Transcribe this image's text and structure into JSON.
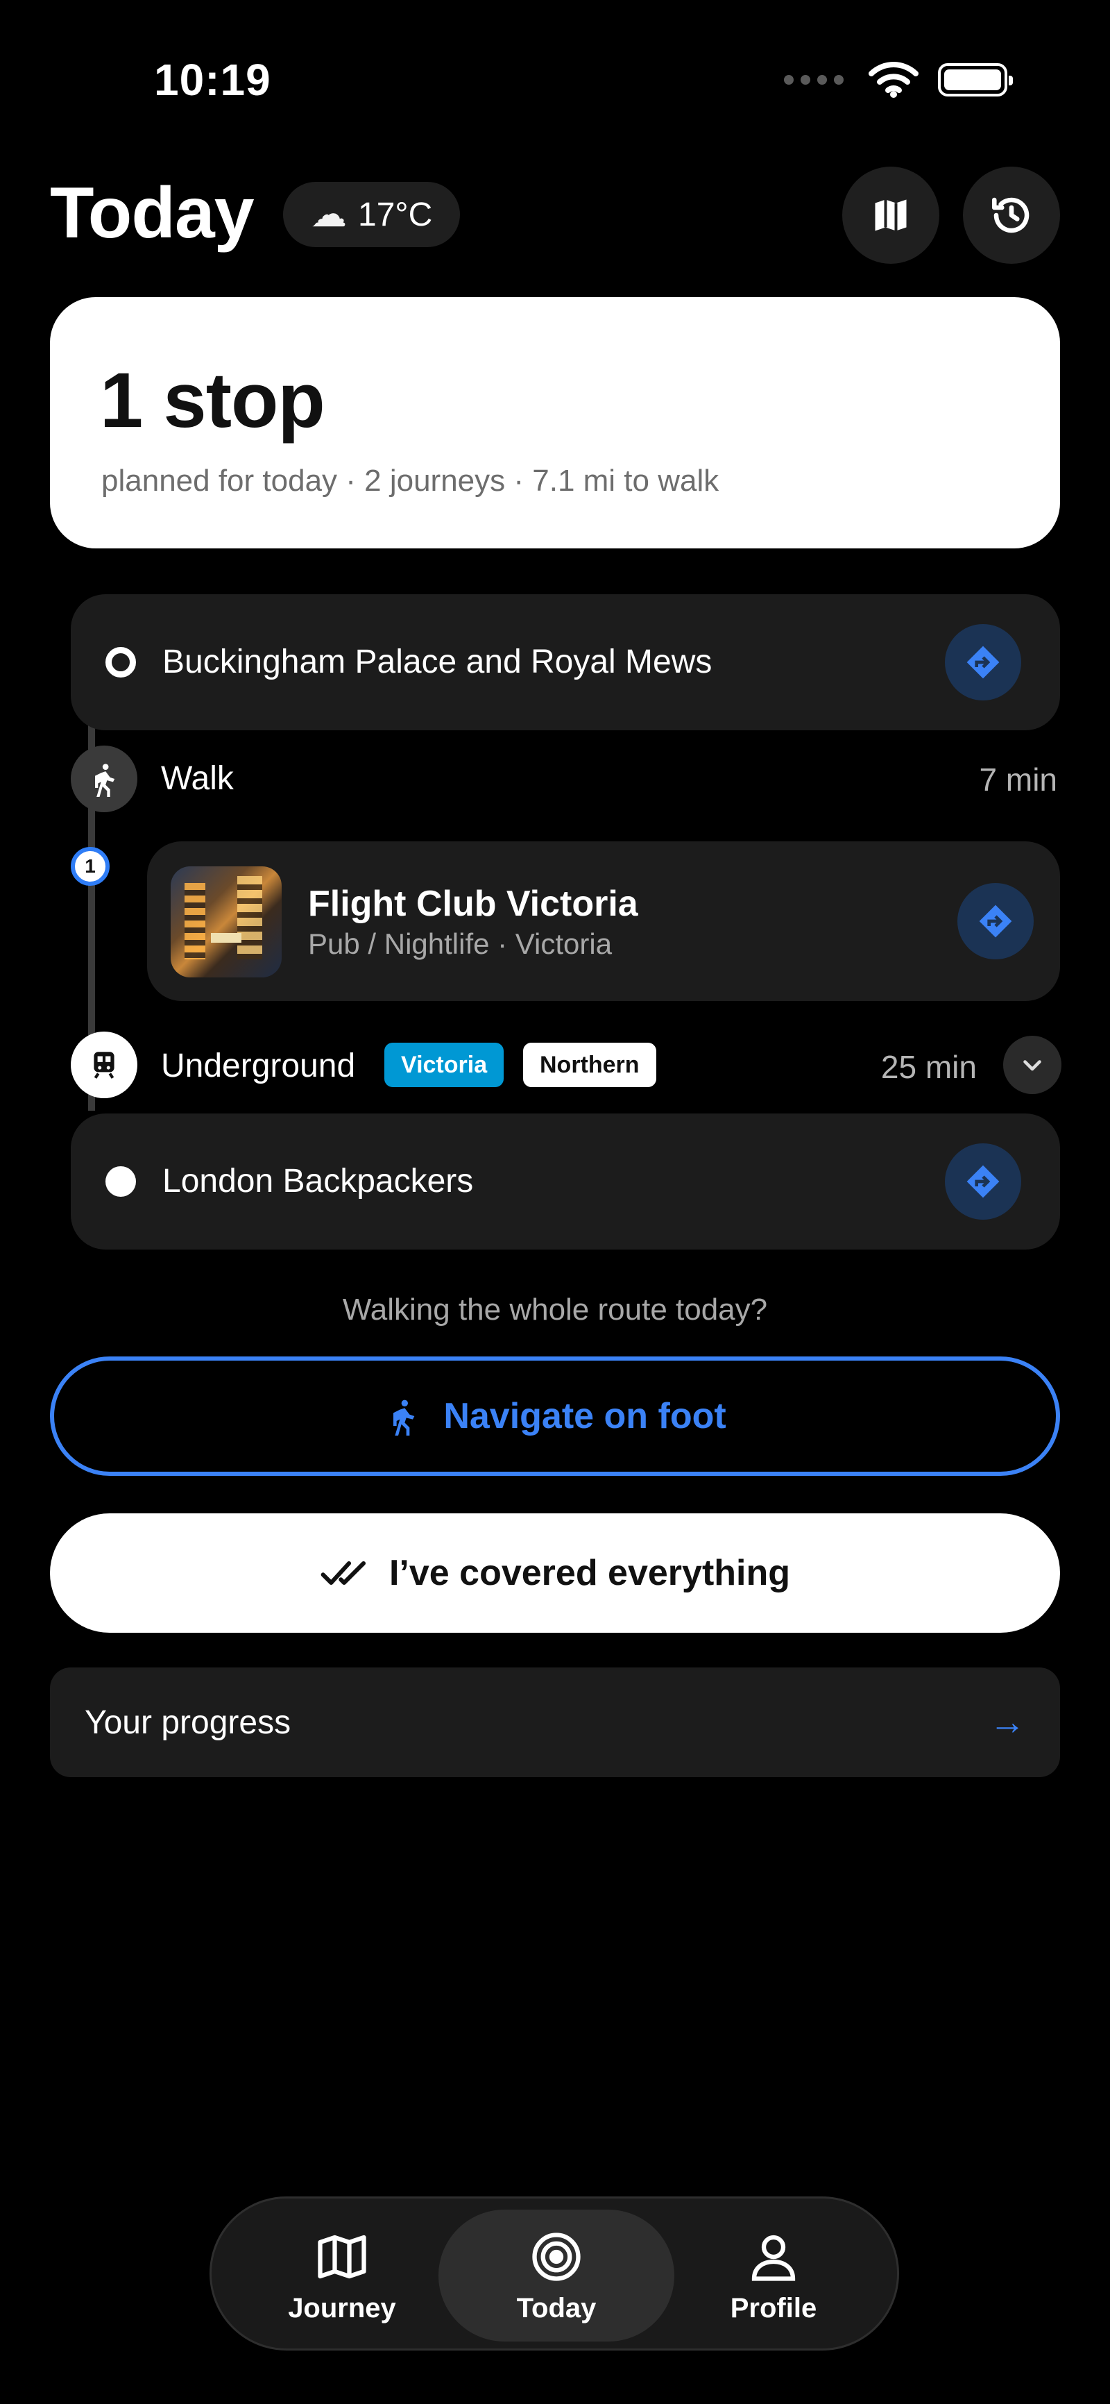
{
  "status_bar": {
    "time": "10:19"
  },
  "header": {
    "title": "Today",
    "weather": {
      "icon": "cloud-icon",
      "temperature": "17°C"
    },
    "map_button": "map-icon",
    "history_button": "history-icon"
  },
  "summary": {
    "count": "1 stop",
    "subtitle": "planned for today · 2 journeys · 7.1 mi to walk"
  },
  "route": {
    "start": {
      "name": "Buckingham Palace and Royal Mews"
    },
    "walk_leg": {
      "label": "Walk",
      "duration": "7 min"
    },
    "visit": {
      "index": "1",
      "title": "Flight Club Victoria",
      "subtitle": "Pub / Nightlife · Victoria"
    },
    "transit_leg": {
      "label": "Underground",
      "duration": "25 min",
      "lines": [
        {
          "name": "Victoria",
          "color": "#0098d4"
        },
        {
          "name": "Northern",
          "color": "#ffffff"
        }
      ]
    },
    "end": {
      "name": "London Backpackers"
    }
  },
  "actions": {
    "prompt": "Walking the whole route today?",
    "navigate_label": "Navigate on foot",
    "covered_label": "I’ve covered everything",
    "progress_label": "Your progress",
    "progress_arrow": "→"
  },
  "tabbar": {
    "tabs": [
      {
        "label": "Journey",
        "icon": "map-icon",
        "active": false
      },
      {
        "label": "Today",
        "icon": "target-icon",
        "active": true
      },
      {
        "label": "Profile",
        "icon": "person-icon",
        "active": false
      }
    ]
  },
  "colors": {
    "accent": "#3b82f6",
    "background": "#000000",
    "card": "#1c1c1c"
  }
}
